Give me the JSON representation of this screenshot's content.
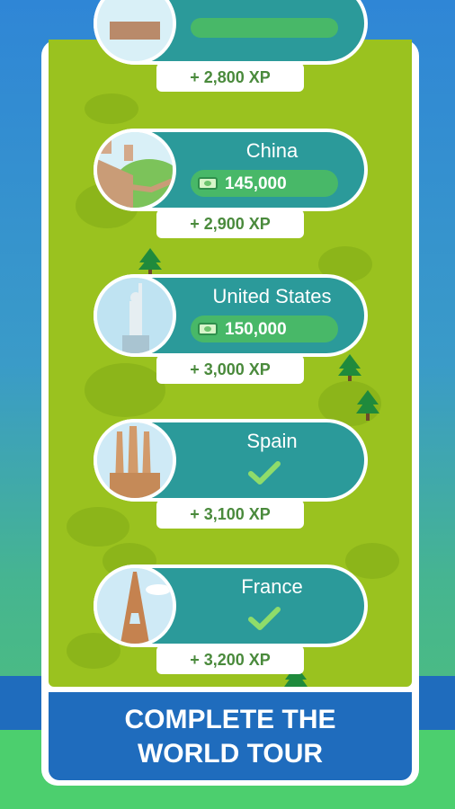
{
  "destinations": [
    {
      "country": "",
      "cost": "",
      "xp": "+ 2,800 XP",
      "status": "partial"
    },
    {
      "country": "China",
      "cost": "145,000",
      "xp": "+ 2,900 XP",
      "status": "locked"
    },
    {
      "country": "United States",
      "cost": "150,000",
      "xp": "+ 3,000 XP",
      "status": "locked"
    },
    {
      "country": "Spain",
      "cost": "",
      "xp": "+ 3,100 XP",
      "status": "completed"
    },
    {
      "country": "France",
      "cost": "",
      "xp": "+ 3,200 XP",
      "status": "completed"
    }
  ],
  "banner": {
    "line1": "COMPLETE THE",
    "line2": "WORLD TOUR"
  },
  "colors": {
    "map": "#9ac21f",
    "pill": "#2b9a9a",
    "cost": "#48b868",
    "banner": "#1f6cbd",
    "xp_text": "#4a8a3c"
  },
  "icons": [
    "cash-icon",
    "checkmark-icon",
    "tree-icon"
  ]
}
